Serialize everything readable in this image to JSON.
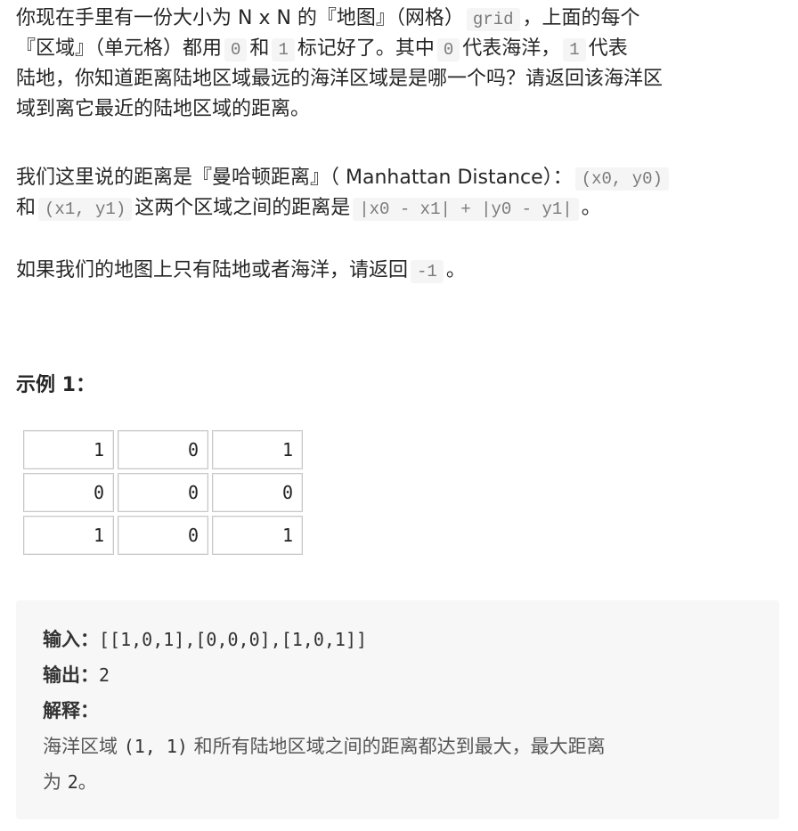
{
  "problem": {
    "p1": [
      [
        "你现在手里有一份大小为 N x N 的『地图』（网格）",
        "grid",
        "，上面的每个"
      ],
      [
        "『区域』（单元格）都用",
        "0",
        "和",
        "1",
        "标记好了。其中",
        "0",
        "代表海洋，",
        "1",
        "代表"
      ],
      [
        "陆地，你知道距离陆地区域最远的海洋区域是是哪一个吗？请返回该海洋区"
      ],
      [
        "域到离它最近的陆地区域的距离。"
      ]
    ],
    "p2": [
      [
        "我们这里说的距离是『曼哈顿距离』（ Manhattan Distance）：",
        "(x0, y0)"
      ],
      [
        "和",
        "(x1, y1)",
        "这两个区域之间的距离是",
        "|x0 - x1| + |y0 - y1|",
        "。"
      ]
    ],
    "p3": [
      "如果我们的地图上只有陆地或者海洋，请返回",
      "-1",
      "。"
    ]
  },
  "example": {
    "heading": "示例 1：",
    "grid": [
      [
        "1",
        "0",
        "1"
      ],
      [
        "0",
        "0",
        "0"
      ],
      [
        "1",
        "0",
        "1"
      ]
    ],
    "input_label": "输入：",
    "input_value": "[[1,0,1],[0,0,0],[1,0,1]]",
    "output_label": "输出：",
    "output_value": "2",
    "explain_label": "解释：",
    "explain_line1_a": "海洋区域",
    "explain_line1_code": "(1, 1)",
    "explain_line1_b": "和所有陆地区域之间的距离都达到最大，最大距离",
    "explain_line2_a": "为",
    "explain_line2_code": "2",
    "explain_line2_b": "。"
  }
}
